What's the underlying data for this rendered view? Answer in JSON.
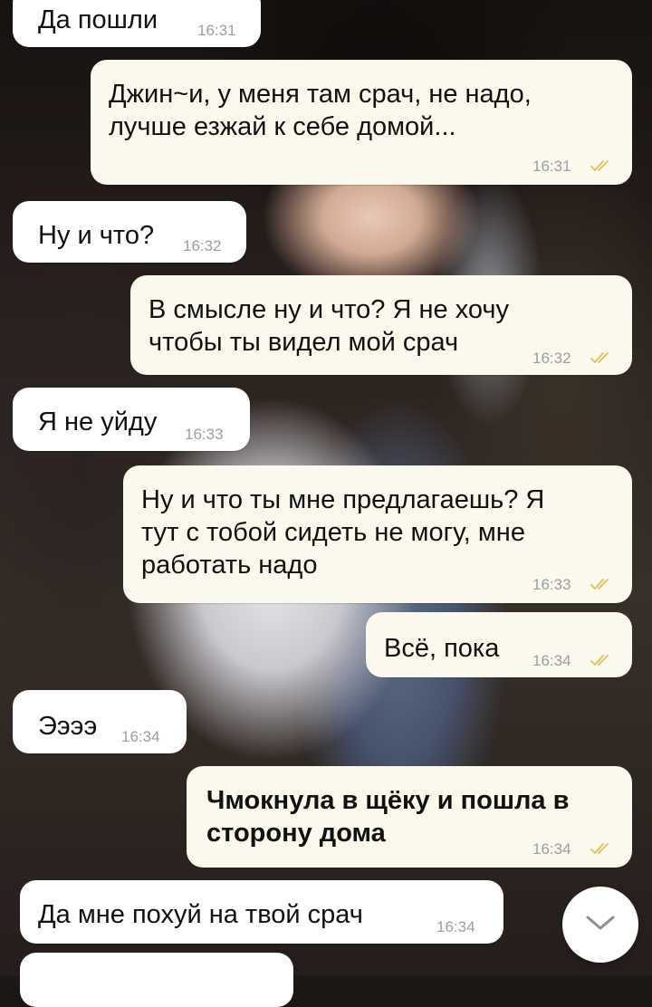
{
  "messages": [
    {
      "text": "Да пошли",
      "time": "16:31",
      "direction": "incoming"
    },
    {
      "text": "Джин~и, у меня там срач, не надо,\nлучше езжай к себе домой...",
      "time": "16:31",
      "direction": "outgoing",
      "status": "read"
    },
    {
      "text": "Ну и что?",
      "time": "16:32",
      "direction": "incoming"
    },
    {
      "text": "В смысле ну и что? Я не хочу\nчтобы ты видел мой срач",
      "time": "16:32",
      "direction": "outgoing",
      "status": "read"
    },
    {
      "text": "Я не уйду",
      "time": "16:33",
      "direction": "incoming"
    },
    {
      "text": "Ну и что ты мне предлагаешь? Я\nтут с тобой сидеть не могу, мне\nработать надо",
      "time": "16:33",
      "direction": "outgoing",
      "status": "read"
    },
    {
      "text": "Всё, пока",
      "time": "16:34",
      "direction": "outgoing",
      "status": "read"
    },
    {
      "text": "Ээээ",
      "time": "16:34",
      "direction": "incoming"
    },
    {
      "text": "Чмокнула в щёку и пошла в\nсторону дома",
      "time": "16:34",
      "direction": "outgoing",
      "status": "read",
      "bold": true
    },
    {
      "text": "Да мне похуй на твой срач",
      "time": "16:34",
      "direction": "incoming"
    }
  ],
  "scroll_button": {
    "icon": "chevron-down-icon"
  },
  "colors": {
    "incoming_bubble": "#ffffff",
    "outgoing_bubble": "#fbf8ec",
    "read_ticks": "#dcc25a",
    "time": "#9aa0a6"
  }
}
